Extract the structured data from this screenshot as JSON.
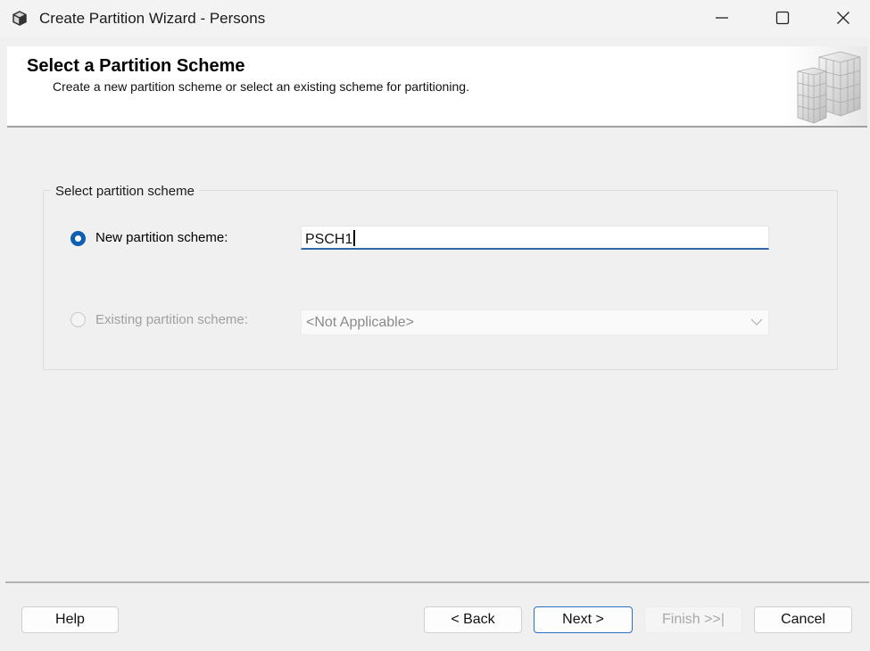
{
  "window": {
    "title": "Create Partition Wizard - Persons",
    "icons": {
      "app": "cube-icon",
      "minimize": "minimize-icon",
      "maximize": "maximize-icon",
      "close": "close-icon"
    }
  },
  "header": {
    "title": "Select a Partition Scheme",
    "subtitle": "Create a new partition scheme or select an existing scheme for partitioning.",
    "art_icon": "partition-cubes-icon"
  },
  "group": {
    "legend": "Select partition scheme",
    "options": [
      {
        "label": "New partition scheme:",
        "selected": true,
        "enabled": true,
        "value": "PSCH1"
      },
      {
        "label": "Existing partition scheme:",
        "selected": false,
        "enabled": false,
        "value": "<Not Applicable>"
      }
    ]
  },
  "footer": {
    "help": "Help",
    "back": "< Back",
    "next": "Next >",
    "finish": "Finish >>|",
    "cancel": "Cancel"
  },
  "colors": {
    "accent": "#0f5fb0",
    "focus_border": "#2a73c4"
  }
}
